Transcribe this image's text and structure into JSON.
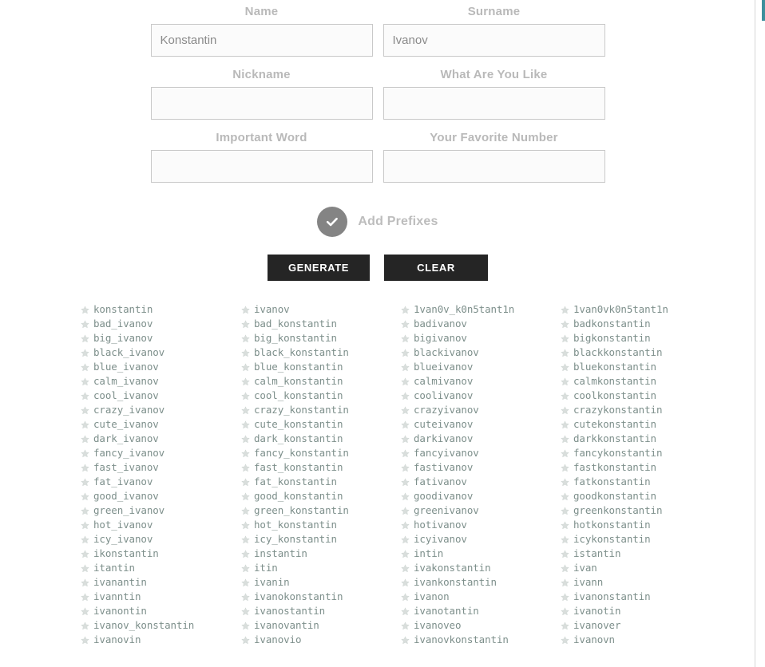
{
  "form": {
    "fields": [
      {
        "label": "Name",
        "value": "Konstantin",
        "placeholder": ""
      },
      {
        "label": "Surname",
        "value": "Ivanov",
        "placeholder": ""
      },
      {
        "label": "Nickname",
        "value": "",
        "placeholder": ""
      },
      {
        "label": "What Are You Like",
        "value": "",
        "placeholder": ""
      },
      {
        "label": "Important Word",
        "value": "",
        "placeholder": ""
      },
      {
        "label": "Your Favorite Number",
        "value": "",
        "placeholder": ""
      }
    ],
    "prefix_toggle": {
      "label": "Add Prefixes",
      "checked": true,
      "icon": "check-icon",
      "circle_color": "#848484"
    },
    "buttons": {
      "generate": "GENERATE",
      "clear": "CLEAR",
      "background_color": "#252525",
      "text_color": "#ffffff"
    }
  },
  "results": {
    "item_icon": "star-icon",
    "text_color": "#7d8f8b",
    "columns": [
      [
        "konstantin",
        "bad_ivanov",
        "big_ivanov",
        "black_ivanov",
        "blue_ivanov",
        "calm_ivanov",
        "cool_ivanov",
        "crazy_ivanov",
        "cute_ivanov",
        "dark_ivanov",
        "fancy_ivanov",
        "fast_ivanov",
        "fat_ivanov",
        "good_ivanov",
        "green_ivanov",
        "hot_ivanov",
        "icy_ivanov",
        "ikonstantin",
        "itantin",
        "ivanantin",
        "ivanntin",
        "ivanontin",
        "ivanov_konstantin",
        "ivanovin"
      ],
      [
        "ivanov",
        "bad_konstantin",
        "big_konstantin",
        "black_konstantin",
        "blue_konstantin",
        "calm_konstantin",
        "cool_konstantin",
        "crazy_konstantin",
        "cute_konstantin",
        "dark_konstantin",
        "fancy_konstantin",
        "fast_konstantin",
        "fat_konstantin",
        "good_konstantin",
        "green_konstantin",
        "hot_konstantin",
        "icy_konstantin",
        "instantin",
        "itin",
        "ivanin",
        "ivanokonstantin",
        "ivanostantin",
        "ivanovantin",
        "ivanovio"
      ],
      [
        "1van0v_k0n5tant1n",
        "badivanov",
        "bigivanov",
        "blackivanov",
        "blueivanov",
        "calmivanov",
        "coolivanov",
        "crazyivanov",
        "cuteivanov",
        "darkivanov",
        "fancyivanov",
        "fastivanov",
        "fativanov",
        "goodivanov",
        "greenivanov",
        "hotivanov",
        "icyivanov",
        "intin",
        "ivakonstantin",
        "ivankonstantin",
        "ivanon",
        "ivanotantin",
        "ivanoveo",
        "ivanovkonstantin"
      ],
      [
        "1van0vk0n5tant1n",
        "badkonstantin",
        "bigkonstantin",
        "blackkonstantin",
        "bluekonstantin",
        "calmkonstantin",
        "coolkonstantin",
        "crazykonstantin",
        "cutekonstantin",
        "darkkonstantin",
        "fancykonstantin",
        "fastkonstantin",
        "fatkonstantin",
        "goodkonstantin",
        "greenkonstantin",
        "hotkonstantin",
        "icykonstantin",
        "istantin",
        "ivan",
        "ivann",
        "ivanonstantin",
        "ivanotin",
        "ivanover",
        "ivanovn"
      ]
    ]
  },
  "scrollbar": {
    "thumb_color": "#3c8f9c",
    "track_color": "#ffffff"
  }
}
